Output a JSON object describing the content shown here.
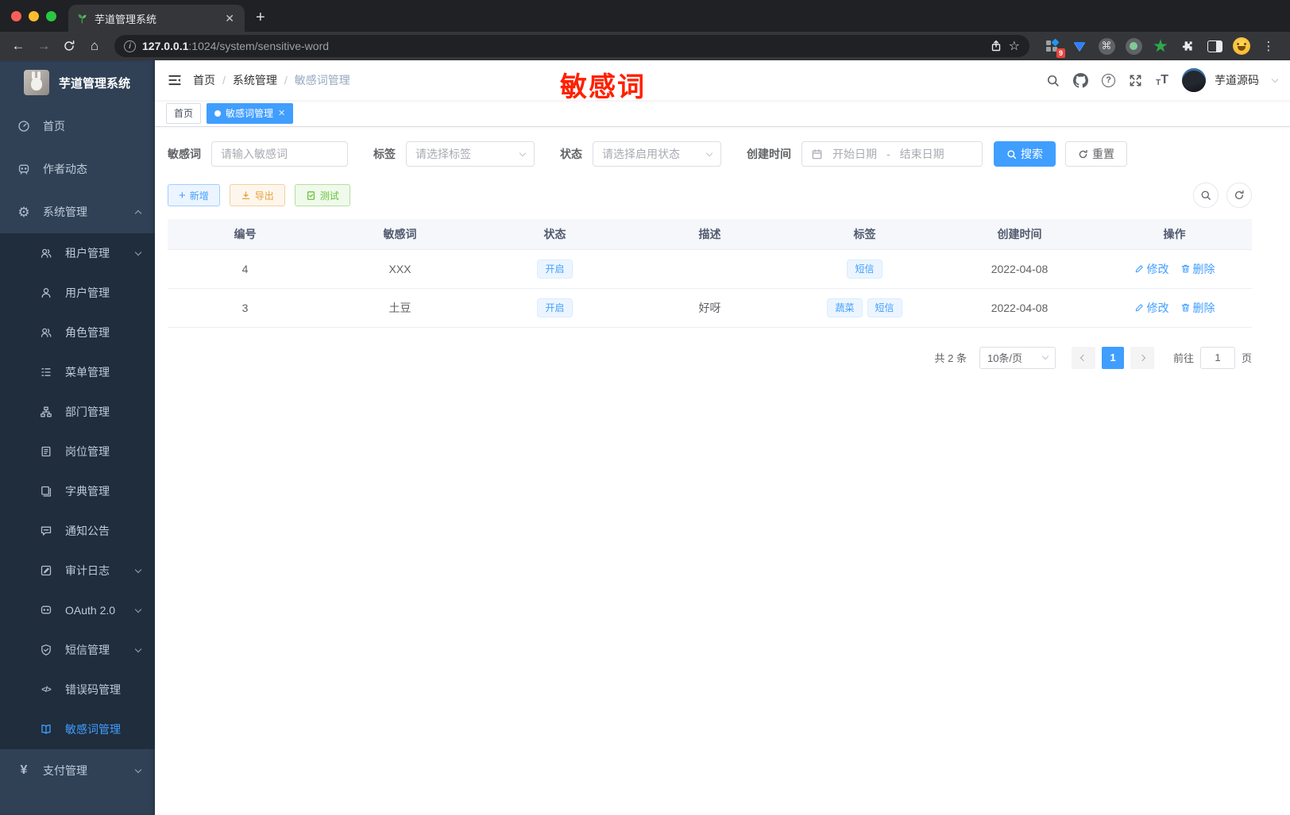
{
  "browser": {
    "tab_title": "芋道管理系统",
    "url_host": "127.0.0.1",
    "url_rest": ":1024/system/sensitive-word",
    "extension_badge": "9"
  },
  "sidebar": {
    "title": "芋道管理系统",
    "items": [
      {
        "label": "首页",
        "icon": "dashboard-icon",
        "level": "main"
      },
      {
        "label": "作者动态",
        "icon": "author-dynamics-icon",
        "level": "main"
      },
      {
        "label": "系统管理",
        "icon": "gear-icon",
        "level": "main",
        "chevron": "up"
      },
      {
        "label": "租户管理",
        "icon": "tenant-icon",
        "level": "sub",
        "chevron": "down"
      },
      {
        "label": "用户管理",
        "icon": "user-icon",
        "level": "sub"
      },
      {
        "label": "角色管理",
        "icon": "role-icon",
        "level": "sub"
      },
      {
        "label": "菜单管理",
        "icon": "menu-tree-icon",
        "level": "sub"
      },
      {
        "label": "部门管理",
        "icon": "department-icon",
        "level": "sub"
      },
      {
        "label": "岗位管理",
        "icon": "post-icon",
        "level": "sub"
      },
      {
        "label": "字典管理",
        "icon": "dictionary-icon",
        "level": "sub"
      },
      {
        "label": "通知公告",
        "icon": "notice-icon",
        "level": "sub"
      },
      {
        "label": "审计日志",
        "icon": "audit-log-icon",
        "level": "sub",
        "chevron": "down"
      },
      {
        "label": "OAuth 2.0",
        "icon": "oauth-icon",
        "level": "sub",
        "chevron": "down"
      },
      {
        "label": "短信管理",
        "icon": "sms-icon",
        "level": "sub",
        "chevron": "down"
      },
      {
        "label": "错误码管理",
        "icon": "error-code-icon",
        "level": "sub"
      },
      {
        "label": "敏感词管理",
        "icon": "sensitive-word-icon",
        "level": "sub",
        "active": true
      },
      {
        "label": "支付管理",
        "icon": "payment-icon",
        "level": "main",
        "chevron": "down"
      }
    ]
  },
  "navbar": {
    "breadcrumb": [
      "首页",
      "系统管理",
      "敏感词管理"
    ],
    "annotation": "敏感词",
    "username": "芋道源码"
  },
  "tags": [
    {
      "label": "首页",
      "active": false,
      "closable": false
    },
    {
      "label": "敏感词管理",
      "active": true,
      "closable": true
    }
  ],
  "filters": {
    "keyword_label": "敏感词",
    "keyword_placeholder": "请输入敏感词",
    "tag_label": "标签",
    "tag_placeholder": "请选择标签",
    "status_label": "状态",
    "status_placeholder": "请选择启用状态",
    "date_label": "创建时间",
    "date_start_placeholder": "开始日期",
    "date_separator": "-",
    "date_end_placeholder": "结束日期",
    "search_label": "搜索",
    "reset_label": "重置"
  },
  "actions": {
    "add_label": "新增",
    "export_label": "导出",
    "test_label": "测试"
  },
  "table": {
    "columns": [
      "编号",
      "敏感词",
      "状态",
      "描述",
      "标签",
      "创建时间",
      "操作"
    ],
    "rows": [
      {
        "id": "4",
        "word": "XXX",
        "status": "开启",
        "description": "",
        "tags": [
          "短信"
        ],
        "created": "2022-04-08"
      },
      {
        "id": "3",
        "word": "土豆",
        "status": "开启",
        "description": "好呀",
        "tags": [
          "蔬菜",
          "短信"
        ],
        "created": "2022-04-08"
      }
    ],
    "edit_label": "修改",
    "delete_label": "删除"
  },
  "pagination": {
    "total": "共 2 条",
    "page_size": "10条/页",
    "current_page": "1",
    "goto_label": "前往",
    "goto_value": "1",
    "page_unit": "页"
  },
  "colors": {
    "accent": "#409eff",
    "warning": "#e6a23c",
    "success": "#67c23a",
    "annotation_red": "#ff2000",
    "sidebar_bg": "#304156",
    "submenu_bg": "#1f2d3d"
  }
}
